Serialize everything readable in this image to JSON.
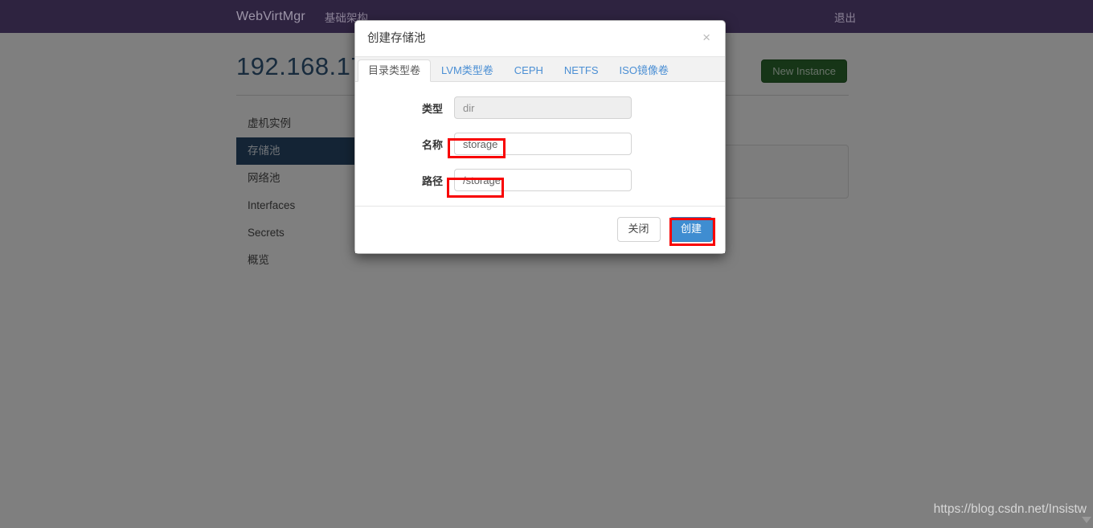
{
  "navbar": {
    "brand": "WebVirtMgr",
    "links": [
      {
        "label": "基础架构"
      }
    ],
    "logout": "退出"
  },
  "content": {
    "page_title": "192.168.17",
    "new_instance_button": "New Instance",
    "sidebar": {
      "items": [
        {
          "label": "虚机实例",
          "active": false
        },
        {
          "label": "存储池",
          "active": true
        },
        {
          "label": "网络池",
          "active": false
        },
        {
          "label": "Interfaces",
          "active": false
        },
        {
          "label": "Secrets",
          "active": false
        },
        {
          "label": "概览",
          "active": false
        }
      ]
    }
  },
  "modal": {
    "title": "创建存储池",
    "close_icon": "×",
    "tabs": [
      {
        "label": "目录类型卷",
        "active": true
      },
      {
        "label": "LVM类型卷",
        "active": false
      },
      {
        "label": "CEPH",
        "active": false
      },
      {
        "label": "NETFS",
        "active": false
      },
      {
        "label": "ISO镜像卷",
        "active": false
      }
    ],
    "fields": [
      {
        "label": "类型",
        "value": "dir",
        "placeholder": "dir",
        "disabled": true
      },
      {
        "label": "名称",
        "value": "storage",
        "placeholder": "",
        "disabled": false
      },
      {
        "label": "路径",
        "value": "/storage",
        "placeholder": "",
        "disabled": false
      }
    ],
    "footer": {
      "close_label": "关闭",
      "create_label": "创建"
    }
  },
  "annotations": {
    "color": "#f80000",
    "targets": [
      "名称-input-text",
      "路径-input-text",
      "创建-button"
    ]
  },
  "watermark": {
    "text": "https://blog.csdn.net/Insistw"
  },
  "colors": {
    "navbar_bg": "#2e2340",
    "sidebar_active_bg": "#28496b",
    "primary_button": "#3f8dd1",
    "new_instance_button": "#2c6b2f",
    "page_title": "#31577a",
    "annotation_red": "#f80000"
  }
}
